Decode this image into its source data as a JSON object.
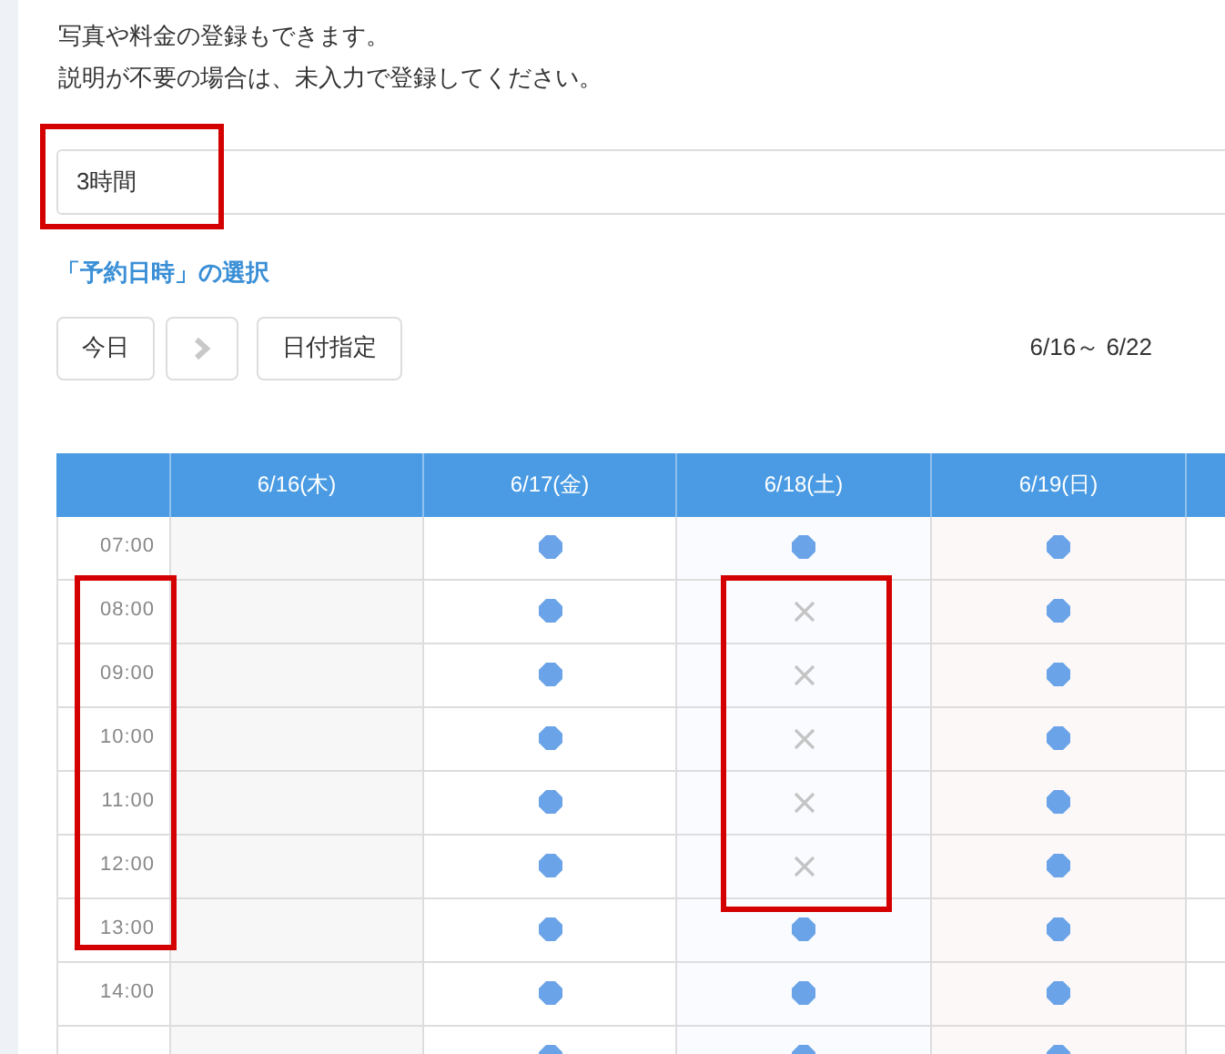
{
  "intro": [
    "写真や料金の登録もできます。",
    "説明が不要の場合は、未入力で登録してください。"
  ],
  "duration_field": {
    "value": "3時間",
    "marked": true
  },
  "section_title": "「予約日時」の選択",
  "toolbar": {
    "today": "今日",
    "next_disabled": true,
    "pick_date": "日付指定",
    "range": "6/16～ 6/22"
  },
  "columns": [
    {
      "label": "6/16(木)",
      "kind": "closed"
    },
    {
      "label": "6/17(金)",
      "kind": "weekday"
    },
    {
      "label": "6/18(土)",
      "kind": "saturday"
    },
    {
      "label": "6/19(日)",
      "kind": "sunday"
    }
  ],
  "rows": [
    {
      "time": "07:00",
      "time_marked": false,
      "cells": [
        {
          "kind": "empty",
          "marked": false
        },
        {
          "kind": "open",
          "marked": false
        },
        {
          "kind": "open",
          "marked": false
        },
        {
          "kind": "open",
          "marked": false
        }
      ]
    },
    {
      "time": "08:00",
      "time_marked": true,
      "cells": [
        {
          "kind": "empty",
          "marked": false
        },
        {
          "kind": "open",
          "marked": false
        },
        {
          "kind": "full",
          "marked": true
        },
        {
          "kind": "open",
          "marked": false
        }
      ]
    },
    {
      "time": "09:00",
      "time_marked": true,
      "cells": [
        {
          "kind": "empty",
          "marked": false
        },
        {
          "kind": "open",
          "marked": false
        },
        {
          "kind": "full",
          "marked": true
        },
        {
          "kind": "open",
          "marked": false
        }
      ]
    },
    {
      "time": "10:00",
      "time_marked": true,
      "cells": [
        {
          "kind": "empty",
          "marked": false
        },
        {
          "kind": "open",
          "marked": false
        },
        {
          "kind": "full",
          "marked": true
        },
        {
          "kind": "open",
          "marked": false
        }
      ]
    },
    {
      "time": "11:00",
      "time_marked": true,
      "cells": [
        {
          "kind": "empty",
          "marked": false
        },
        {
          "kind": "open",
          "marked": false
        },
        {
          "kind": "full",
          "marked": true
        },
        {
          "kind": "open",
          "marked": false
        }
      ]
    },
    {
      "time": "12:00",
      "time_marked": true,
      "cells": [
        {
          "kind": "empty",
          "marked": false
        },
        {
          "kind": "open",
          "marked": false
        },
        {
          "kind": "full",
          "marked": true
        },
        {
          "kind": "open",
          "marked": false
        }
      ]
    },
    {
      "time": "13:00",
      "time_marked": true,
      "cells": [
        {
          "kind": "empty",
          "marked": false
        },
        {
          "kind": "open",
          "marked": false
        },
        {
          "kind": "open",
          "marked": false
        },
        {
          "kind": "open",
          "marked": false
        }
      ]
    },
    {
      "time": "14:00",
      "time_marked": false,
      "cells": [
        {
          "kind": "empty",
          "marked": false
        },
        {
          "kind": "open",
          "marked": false
        },
        {
          "kind": "open",
          "marked": false
        },
        {
          "kind": "open",
          "marked": false
        }
      ]
    },
    {
      "time_marked": false,
      "cells": [
        {
          "kind": "empty",
          "marked": false
        },
        {
          "kind": "open",
          "marked": false
        },
        {
          "kind": "open",
          "marked": false
        },
        {
          "kind": "open",
          "marked": false
        }
      ]
    }
  ]
}
